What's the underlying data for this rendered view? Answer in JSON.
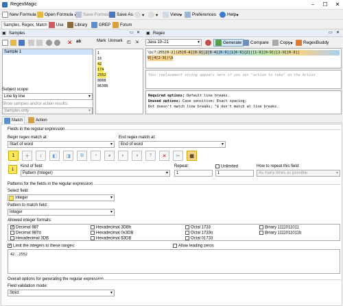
{
  "window": {
    "title": "RegexMagic"
  },
  "toolbar": {
    "new_formula": "New Formula",
    "open_formula": "Open Formula",
    "save_formula": "Save Formula",
    "save_as": "Save As",
    "view": "View",
    "preferences": "Preferences",
    "help": "Help"
  },
  "main_tabs": [
    "Samples, Regex, Match",
    "Use",
    "Library",
    "GREP",
    "Forum"
  ],
  "samples": {
    "header": "Samples",
    "items": [
      "Sample 1"
    ],
    "mark_label": "Mark",
    "unmark_label": "Unmark",
    "text_lines": [
      "1",
      "16",
      "42",
      "174",
      "2552",
      "8088",
      "86386"
    ],
    "highlighted": [
      false,
      false,
      true,
      true,
      true,
      false,
      false
    ],
    "subject_scope_label": "Subject scope:",
    "subject_scope_value": "Line by line",
    "show_label": "Show samples and/or action results:",
    "show_value": "Samples only"
  },
  "regex": {
    "header": "Regex",
    "flavor": "Java 19–21",
    "generate_label": "Generate",
    "compare_label": "Compare",
    "copy_label": "Copy",
    "regexbuddy_label": "RegexBuddy",
    "line1": "\\b(?:255[0-2]|25[0-4][0-9]|2[0-4][0-9]|1[0-9]{2}|[1-9][0-9]|[2-9][0-9]|",
    "line2": "9]|4[2-9])\\b",
    "replacement_placeholder": "Your replacement string appears here if you set \"action to take\" on the Action",
    "options_required": "Required options:",
    "options_required_val": "Default line breaks.",
    "options_unused": "Unused options:",
    "options_unused_val": "Case sensitive; Exact spacing;",
    "options_note": "Dot doesn't match line breaks; ^$ don't match at line breaks."
  },
  "bottom_tabs": [
    "Match",
    "Action"
  ],
  "match": {
    "fields_header": "Fields in the regular expression",
    "begin_label": "Begin regex match at:",
    "begin_value": "Start of word",
    "end_label": "End regex match at:",
    "end_value": "End of word",
    "field_number": "1",
    "kind_label": "Kind of field:",
    "kind_value": "Pattern (Integer)",
    "repeat_label": "Repeat:",
    "repeat_value": "1",
    "unlimited_label": "Unlimited",
    "unlimited_value": "1",
    "how_repeat_label": "How to repeat this field:",
    "how_repeat_value": "As many times as possible",
    "patterns_header": "Patterns for the fields in the regular expression",
    "select_field_label": "Select field:",
    "select_field_value": "Integer",
    "pattern_label": "Pattern to match field:",
    "pattern_value": "Integer",
    "allowed_label": "Allowed integer formats:",
    "formats": [
      {
        "label": "Decimal 987",
        "checked": true
      },
      {
        "label": "Hexadecimal 3DBh",
        "checked": false
      },
      {
        "label": "Octal 1733",
        "checked": false
      },
      {
        "label": "Binary 1111011011",
        "checked": false
      },
      {
        "label": "Decimal 987d",
        "checked": false
      },
      {
        "label": "Hexadecimal 0x3DB",
        "checked": false
      },
      {
        "label": "Octal 1733o",
        "checked": false
      },
      {
        "label": "Binary 1111011011b",
        "checked": false
      },
      {
        "label": "Hexadecimal 3DB",
        "checked": false
      },
      {
        "label": "Hexadecimal $3DB",
        "checked": false
      },
      {
        "label": "Octal 01733",
        "checked": false
      }
    ],
    "limit_label": "Limit the integers to these ranges:",
    "allow_zeros_label": "Allow leading zeros",
    "range_value": "42..2552",
    "overall_header": "Overall options for generating the regular expression",
    "validation_label": "Field validation mode:",
    "validation_value": "Strict"
  },
  "colors": {
    "highlight": "#ffe75e",
    "generate_bg": "#d6e8fb"
  }
}
